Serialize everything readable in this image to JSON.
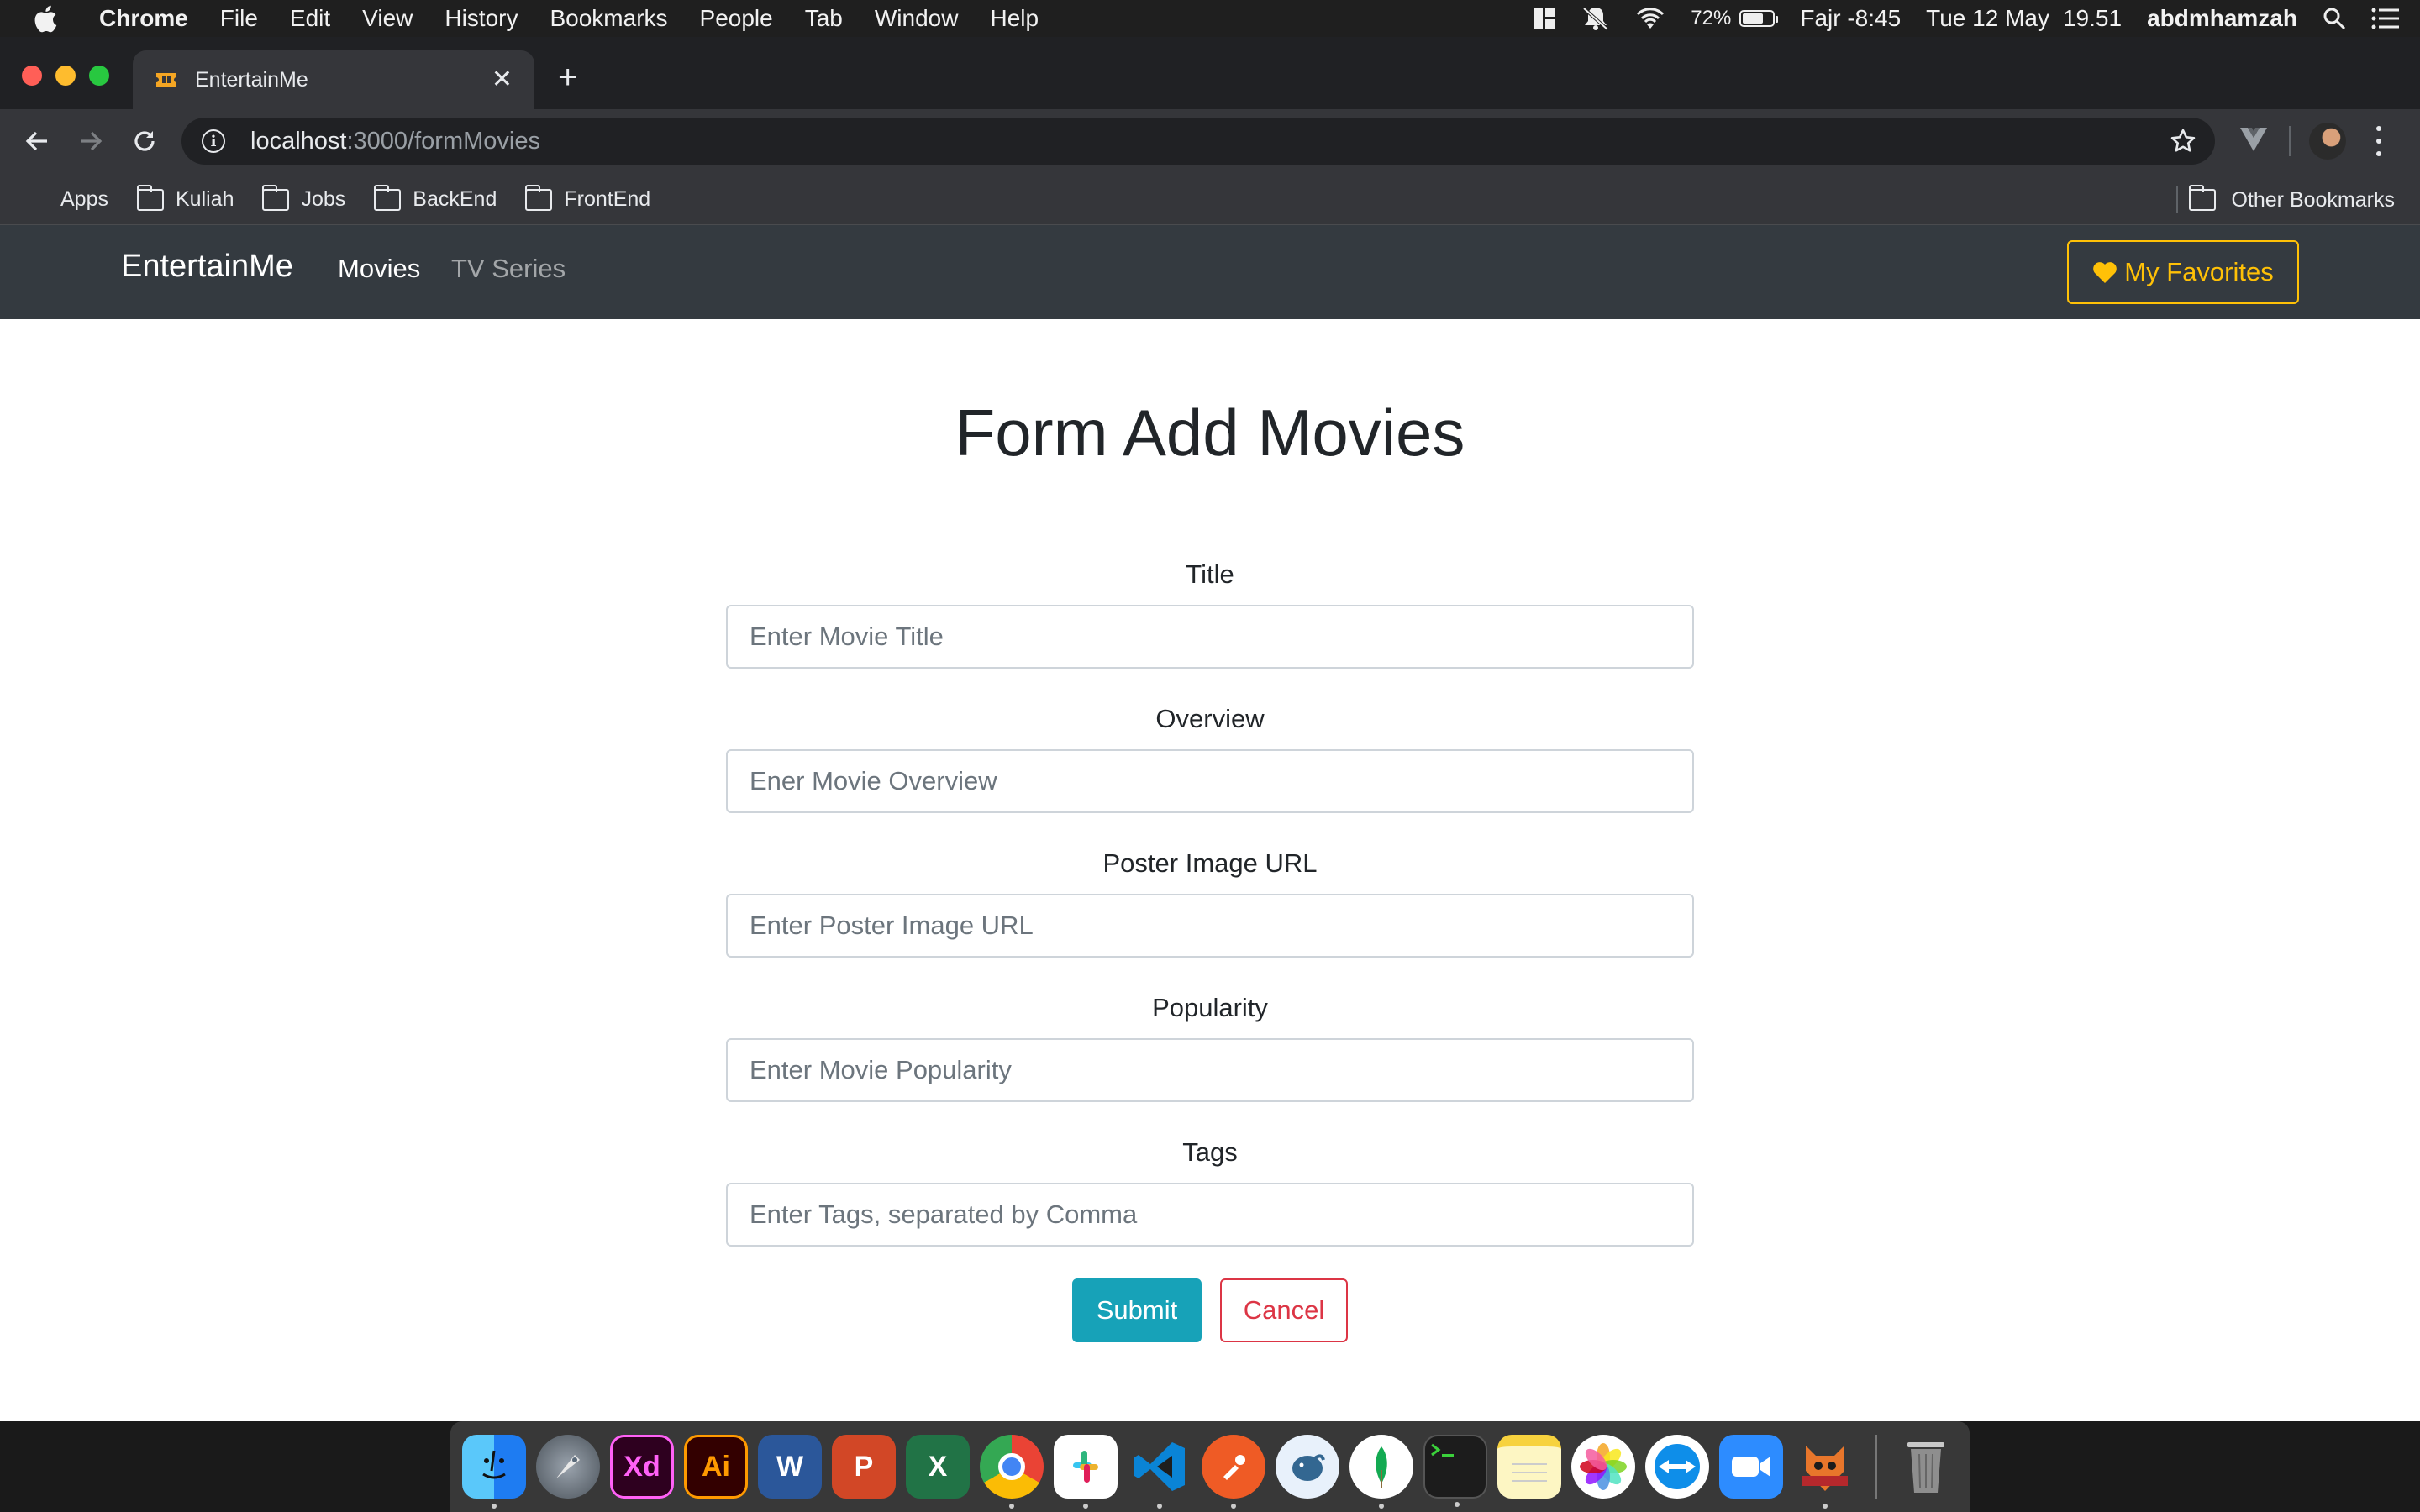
{
  "menubar": {
    "app_name": "Chrome",
    "menus": [
      "File",
      "Edit",
      "View",
      "History",
      "Bookmarks",
      "People",
      "Tab",
      "Window",
      "Help"
    ],
    "battery_percent": "72%",
    "battery_level": 0.72,
    "prayer_time": "Fajr -8:45",
    "date": "Tue 12 May",
    "time": "19.51",
    "user": "abdmhamzah"
  },
  "browser": {
    "tab_title": "EntertainMe",
    "url_host": "localhost",
    "url_path": ":3000/formMovies",
    "bookmarks": {
      "apps": "Apps",
      "folders": [
        "Kuliah",
        "Jobs",
        "BackEnd",
        "FrontEnd"
      ],
      "other": "Other Bookmarks"
    }
  },
  "navbar": {
    "brand": "EntertainMe",
    "links": [
      "Movies",
      "TV Series"
    ],
    "favorites_button": "My Favorites"
  },
  "form": {
    "title": "Form Add Movies",
    "fields": [
      {
        "label": "Title",
        "placeholder": "Enter Movie Title",
        "value": ""
      },
      {
        "label": "Overview",
        "placeholder": "Ener Movie Overview",
        "value": ""
      },
      {
        "label": "Poster Image URL",
        "placeholder": "Enter Poster Image URL",
        "value": ""
      },
      {
        "label": "Popularity",
        "placeholder": "Enter Movie Popularity",
        "value": ""
      },
      {
        "label": "Tags",
        "placeholder": "Enter Tags, separated by Comma",
        "value": ""
      }
    ],
    "submit_label": "Submit",
    "cancel_label": "Cancel"
  },
  "colors": {
    "navbar_bg": "#343a40",
    "favorites_accent": "#ffc107",
    "submit_bg": "#17a2b8",
    "cancel_accent": "#dc3545"
  },
  "dock": {
    "apps": [
      "finder-icon",
      "launchpad-icon",
      "adobe-xd-icon",
      "adobe-illustrator-icon",
      "word-icon",
      "powerpoint-icon",
      "excel-icon",
      "chrome-icon",
      "slack-icon",
      "vscode-icon",
      "postman-icon",
      "tableplus-icon",
      "mongodb-compass-icon",
      "terminal-icon",
      "notes-icon",
      "photos-icon",
      "teamviewer-icon",
      "zoom-icon",
      "hacktiv8-icon",
      "trash-icon"
    ],
    "labels": {
      "xd": "Xd",
      "ai": "Ai",
      "word": "W",
      "powerpoint": "P",
      "excel": "X"
    }
  }
}
